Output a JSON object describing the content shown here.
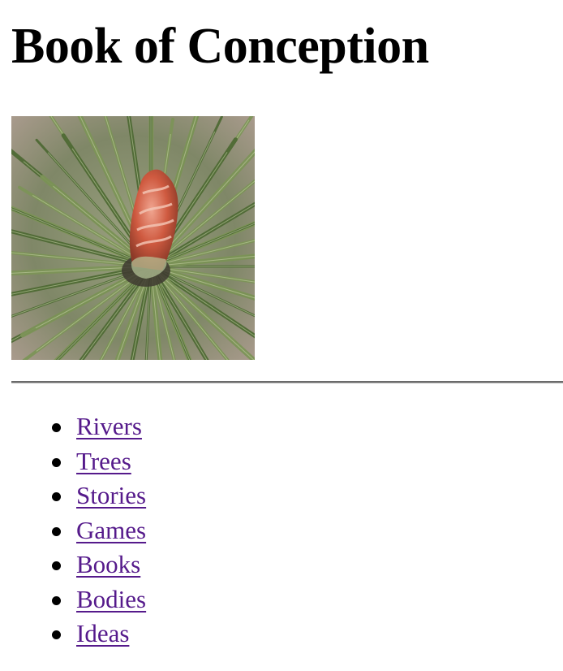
{
  "page": {
    "title": "Book of Conception"
  },
  "hero_image": {
    "subject": "pine-shoot-with-red-bud",
    "colors": {
      "needle": "#7d9458",
      "needle_dark": "#4f6a35",
      "bud": "#c9533a",
      "bud_light": "#e9a08c",
      "background": "#8a8f73"
    }
  },
  "nav": {
    "link_color": "#551a8b",
    "items": [
      {
        "label": "Rivers"
      },
      {
        "label": "Trees"
      },
      {
        "label": "Stories"
      },
      {
        "label": "Games"
      },
      {
        "label": "Books"
      },
      {
        "label": "Bodies"
      },
      {
        "label": "Ideas"
      }
    ]
  }
}
